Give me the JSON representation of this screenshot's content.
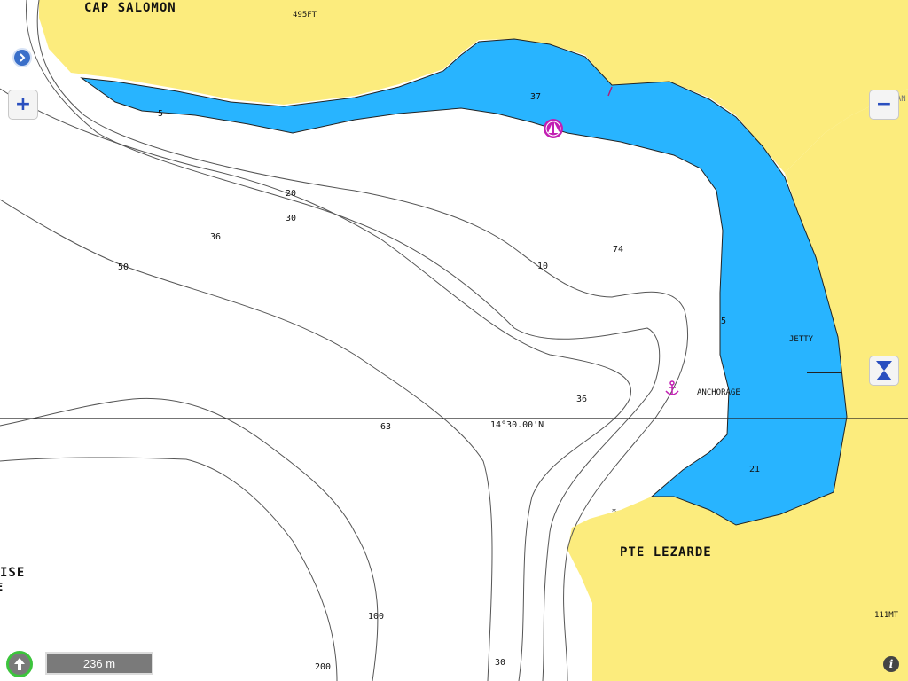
{
  "colors": {
    "land": "#fcec7d",
    "shallow": "#28b4ff",
    "deep": "#ffffff",
    "contour": "#555555",
    "marker": "#c21fb3"
  },
  "places": {
    "cap_salomon": "CAP SALOMON",
    "pte_lezarde": "PTE LEZARDE",
    "cut_left_1": "ISE",
    "cut_left_2": "E",
    "gran": "GRAN"
  },
  "heights": {
    "h495": "495FT",
    "h111": "111MT"
  },
  "features": {
    "jetty": "JETTY",
    "anchorage": "ANCHORAGE"
  },
  "latitude_label": "14°30.00'N",
  "depths": {
    "d5a": "5",
    "d37": "37",
    "d20": "20",
    "d30a": "30",
    "d36a": "36",
    "d50": "50",
    "d74": "74",
    "d10": "10",
    "d5b": "5",
    "d36b": "36",
    "d63": "63",
    "d21": "21",
    "d100": "100",
    "d200": "200",
    "d30b": "30"
  },
  "controls": {
    "zoom_in": "+",
    "zoom_out": "−",
    "scale": "236 m"
  },
  "icons": {
    "expand": "chevron-right-icon",
    "zoom_in": "plus-icon",
    "zoom_out": "minus-icon",
    "tide": "hourglass-icon",
    "north": "north-arrow-icon",
    "info": "info-icon",
    "boat": "sailboat-icon",
    "anchor": "anchor-icon"
  }
}
